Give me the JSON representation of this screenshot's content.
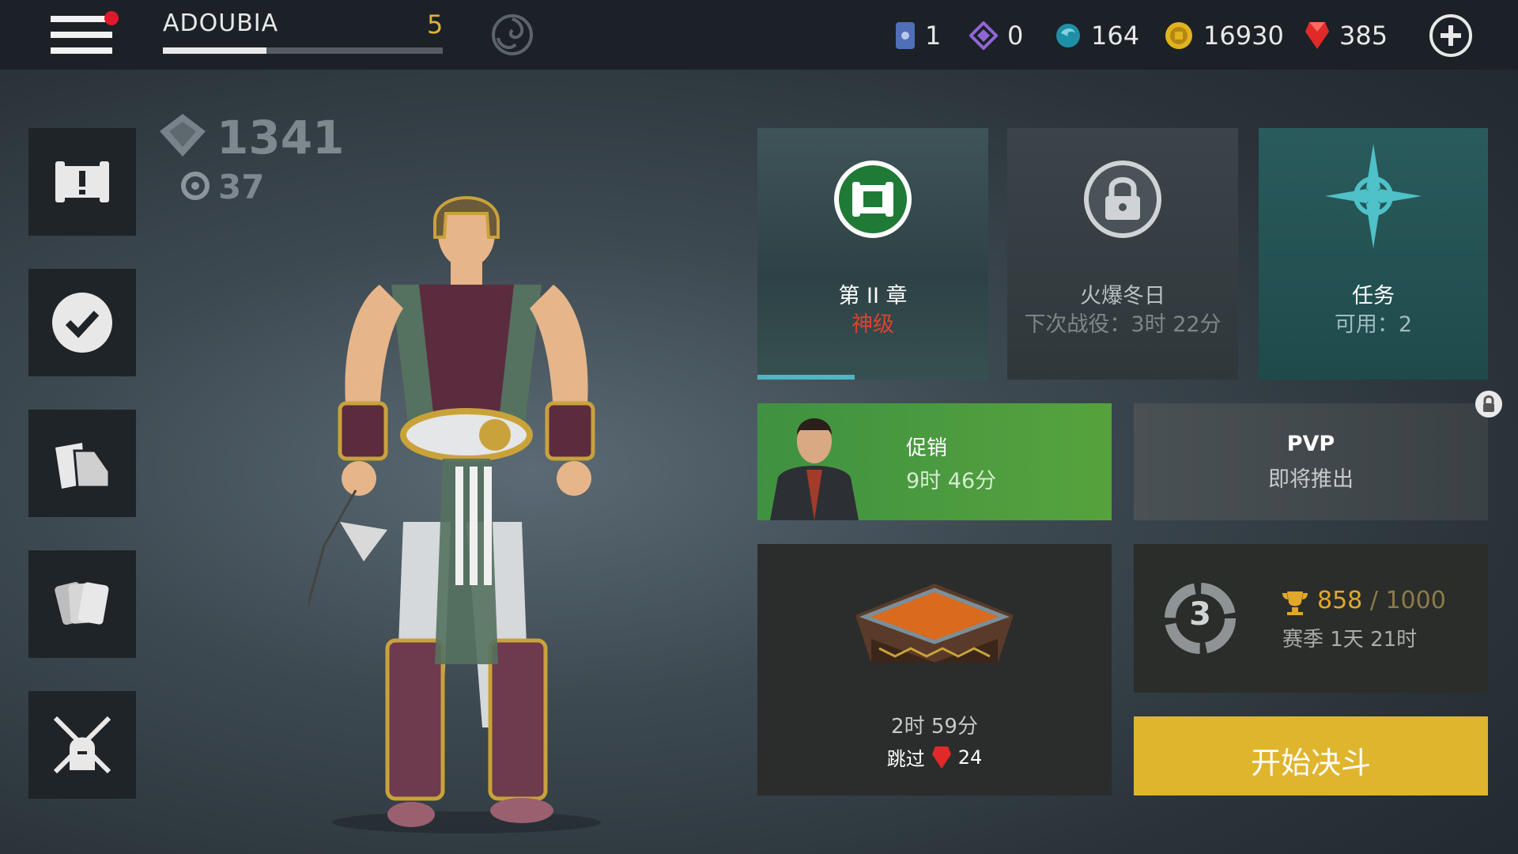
{
  "topbar": {
    "player_name": "ADOUBIA",
    "level": "5",
    "xp_progress": 0.37,
    "currencies": {
      "tickets": "1",
      "crystals": "0",
      "orbs": "164",
      "coins": "16930",
      "gems": "385"
    }
  },
  "stats": {
    "power": "1341",
    "secondary": "37"
  },
  "tiles": {
    "chapter": {
      "title": "第 II 章",
      "difficulty": "神级",
      "progress": 0.42
    },
    "winter": {
      "title": "火爆冬日",
      "next": "下次战役：3时 22分"
    },
    "missions": {
      "title": "任务",
      "available": "可用：2"
    },
    "promo": {
      "title": "促销",
      "timer": "9时 46分"
    },
    "pvp": {
      "title": "PVP",
      "status": "即将推出"
    },
    "chest": {
      "timer": "2时 59分",
      "skip_label": "跳过",
      "skip_cost": "24"
    },
    "season": {
      "rank": "3",
      "score": "858",
      "target": "/ 1000",
      "remaining": "赛季 1天 21时"
    },
    "fight": {
      "label": "开始决斗"
    }
  },
  "colors": {
    "accent_gold": "#e0b52e",
    "promo_green": "#4e9e3e",
    "mission_teal": "#2a5b5c",
    "difficulty_red": "#d9432f"
  }
}
